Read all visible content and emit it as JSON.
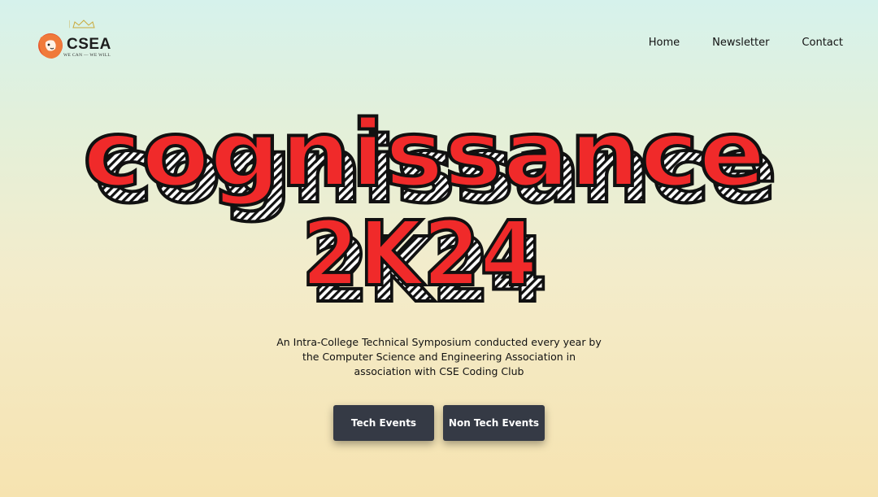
{
  "brand": {
    "logo_text": "CSEA",
    "tagline": "WE CAN — WE WILL",
    "icon": "lion-crown-logo-icon",
    "accent": "#e8542a"
  },
  "nav": {
    "items": [
      {
        "label": "Home"
      },
      {
        "label": "Newsletter"
      },
      {
        "label": "Contact"
      }
    ]
  },
  "hero": {
    "title_line1": "cognissance",
    "title_line2": "2K24",
    "title_color": "#f02a2a",
    "outline_color": "#111111",
    "subtitle": "An Intra-College Technical Symposium conducted every year by the Computer Science and Engineering Association in association with CSE Coding Club"
  },
  "actions": {
    "tech_label": "Tech Events",
    "non_tech_label": "Non Tech Events",
    "button_color": "#353a45"
  }
}
